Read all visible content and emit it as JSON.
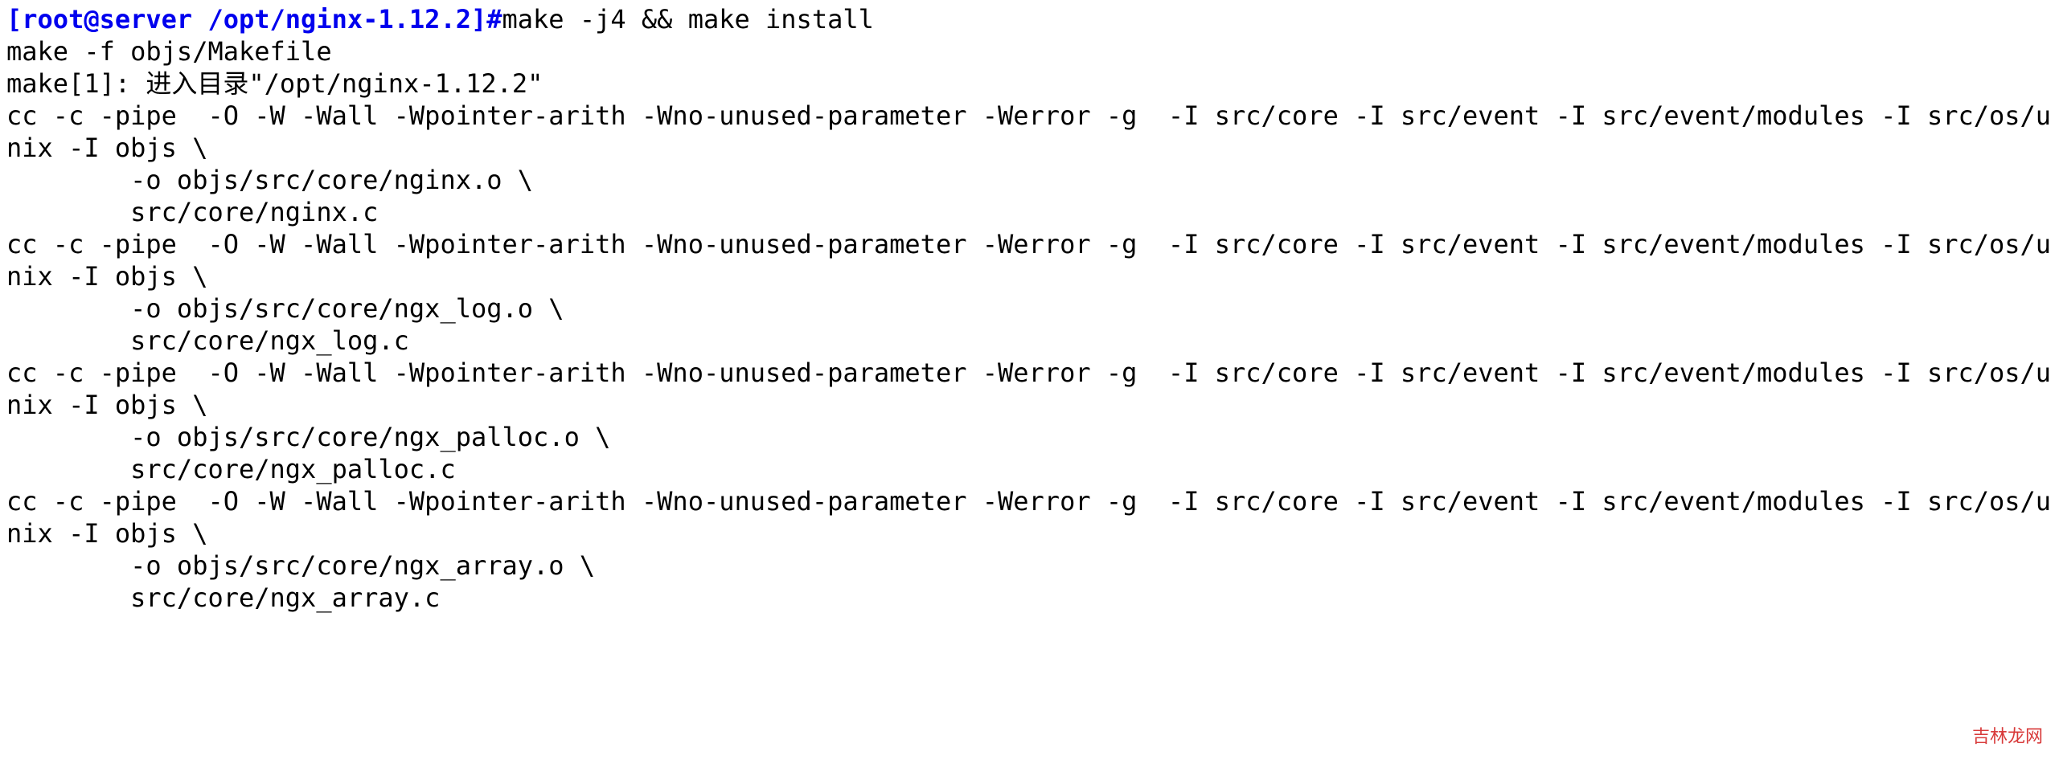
{
  "prompt": "[root@server /opt/nginx-1.12.2]#",
  "command": "make -j4 && make install",
  "output_lines": [
    "make -f objs/Makefile",
    "make[1]: 进入目录\"/opt/nginx-1.12.2\"",
    "cc -c -pipe  -O -W -Wall -Wpointer-arith -Wno-unused-parameter -Werror -g  -I src/core -I src/event -I src/event/modules -I src/os/unix -I objs \\",
    "        -o objs/src/core/nginx.o \\",
    "        src/core/nginx.c",
    "cc -c -pipe  -O -W -Wall -Wpointer-arith -Wno-unused-parameter -Werror -g  -I src/core -I src/event -I src/event/modules -I src/os/unix -I objs \\",
    "        -o objs/src/core/ngx_log.o \\",
    "        src/core/ngx_log.c",
    "cc -c -pipe  -O -W -Wall -Wpointer-arith -Wno-unused-parameter -Werror -g  -I src/core -I src/event -I src/event/modules -I src/os/unix -I objs \\",
    "        -o objs/src/core/ngx_palloc.o \\",
    "        src/core/ngx_palloc.c",
    "cc -c -pipe  -O -W -Wall -Wpointer-arith -Wno-unused-parameter -Werror -g  -I src/core -I src/event -I src/event/modules -I src/os/unix -I objs \\",
    "        -o objs/src/core/ngx_array.o \\",
    "        src/core/ngx_array.c"
  ],
  "watermark": "吉林龙网"
}
